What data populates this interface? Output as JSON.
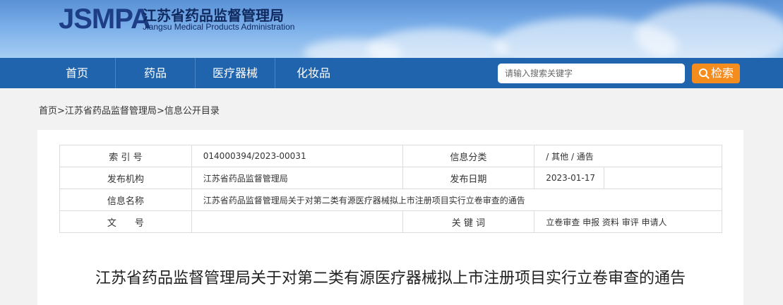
{
  "header": {
    "logo_abbr": "JSMPA",
    "logo_cn": "江苏省药品监督管理局",
    "logo_en": "Jiangsu Medical Products Administration"
  },
  "nav": {
    "items": [
      "首页",
      "药品",
      "医疗器械",
      "化妆品"
    ],
    "search_placeholder": "请输入搜索关键字",
    "search_button": "检索"
  },
  "breadcrumb": [
    "首页",
    ">",
    "江苏省药品监督管理局",
    ">",
    "信息公开目录"
  ],
  "meta": {
    "index_label": "索 引 号",
    "index_value": "014000394/2023-00031",
    "category_label": "信息分类",
    "category_value": "/  其他  /  通告",
    "org_label": "发布机构",
    "org_value": "江苏省药品监督管理局",
    "date_label": "发布日期",
    "date_value": "2023-01-17",
    "name_label": "信息名称",
    "name_value": "江苏省药品监督管理局关于对第二类有源医疗器械拟上市注册项目实行立卷审查的通告",
    "docno_label": "文　　号",
    "docno_value": "",
    "keywords_label": "关 键 词",
    "keywords_value": "立卷审查 申报 资料 审评 申请人"
  },
  "article": {
    "title": "江苏省药品监督管理局关于对第二类有源医疗器械拟上市注册项目实行立卷审查的通告"
  }
}
